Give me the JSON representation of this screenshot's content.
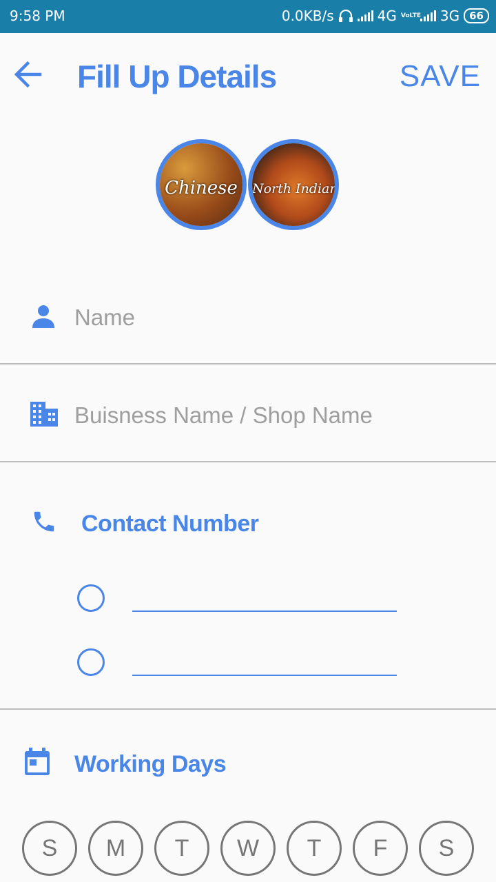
{
  "status": {
    "time": "9:58 PM",
    "speed": "0.0KB/s",
    "net1": "4G",
    "volte": "VoLTE",
    "net2": "3G",
    "battery": "66"
  },
  "header": {
    "title": "Fill Up Details",
    "save_label": "SAVE"
  },
  "cuisines": [
    {
      "label": "Chinese"
    },
    {
      "label": "North Indian"
    }
  ],
  "form": {
    "name_placeholder": "Name",
    "business_placeholder": "Buisness Name / Shop Name",
    "contact_title": "Contact Number",
    "working_days_title": "Working Days"
  },
  "days": [
    "S",
    "M",
    "T",
    "W",
    "T",
    "F",
    "S"
  ],
  "colors": {
    "accent": "#4a86e8",
    "status_bar": "#1a7fa8",
    "divider": "#bdbdbd"
  }
}
